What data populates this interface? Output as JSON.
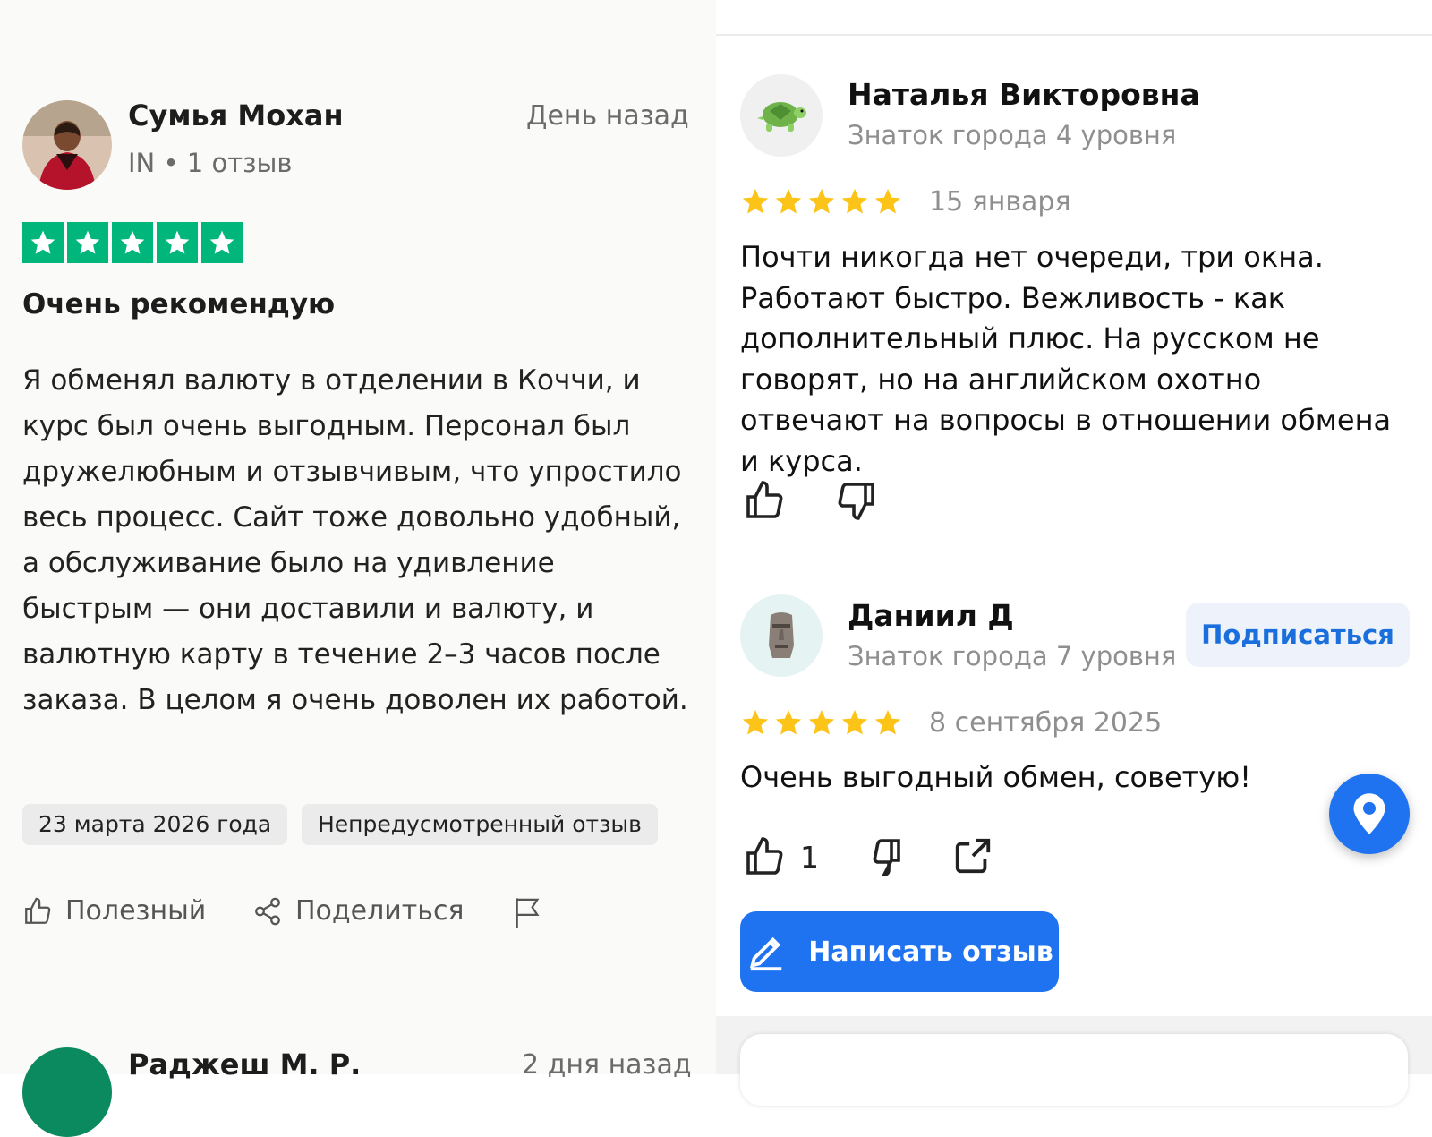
{
  "left_review": {
    "author": "Сумья Мохан",
    "meta": "IN • 1 отзыв",
    "date": "День назад",
    "rating": 5,
    "title": "Очень рекомендую",
    "body": "Я обменял валюту в отделении в Коччи, и курс был очень выгодным. Персонал был дружелюбным и отзывчивым, что упростило весь процесс. Сайт тоже довольно удобный, а обслуживание было на удивление быстрым — они доставили и валюту, и валютную карту в течение 2–3 часов после заказа. В целом я очень доволен их работой.",
    "date_chip": "23 марта 2026 года",
    "type_chip": "Непредусмотренный отзыв",
    "actions": {
      "useful": "Полезный",
      "share": "Поделиться"
    },
    "accent_color": "#00b67a"
  },
  "left_next_review": {
    "author": "Раджеш М. Р.",
    "date": "2 дня назад"
  },
  "right_reviews": [
    {
      "author": "Наталья Викторовна",
      "level": "Знаток города 4 уровня",
      "rating": 5,
      "date": "15 января",
      "text": "Почти никогда нет очереди, три окна. Работают быстро. Вежливость - как дополнительный плюс. На русском не говорят, но на английском охотно отвечают на вопросы в отношении обмена и курса.",
      "avatar_icon": "turtle-icon"
    },
    {
      "author": "Даниил Д",
      "level": "Знаток города 7 уровня",
      "rating": 5,
      "date": "8 сентября 2025",
      "text": "Очень выгодный обмен, советую!",
      "likes": "1",
      "subscribe_label": "Подписаться",
      "avatar_icon": "moai-icon"
    }
  ],
  "write_review_label": "Написать отзыв",
  "colors": {
    "yandex_blue": "#1f73f0",
    "star_yellow": "#fcc419"
  }
}
